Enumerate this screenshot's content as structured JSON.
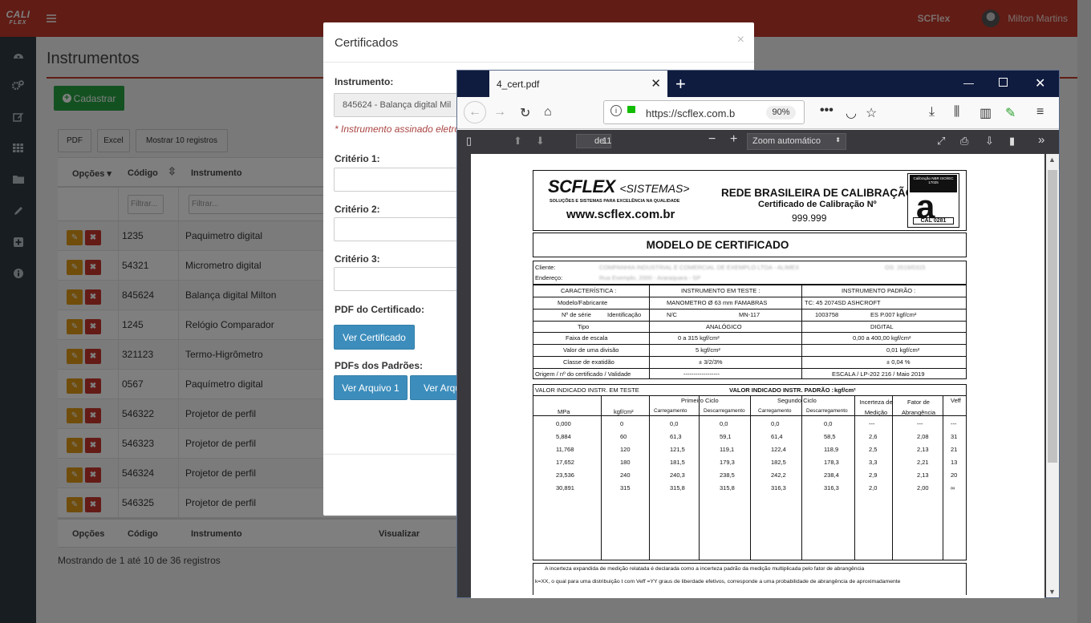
{
  "app": {
    "logo_line1": "CALI",
    "logo_line2": "FLEX",
    "brand": "SCFlex",
    "user": "Milton Martins"
  },
  "sidebar": [
    {
      "icon": "dashboard-icon"
    },
    {
      "icon": "cogs-icon"
    },
    {
      "icon": "edit-icon"
    },
    {
      "icon": "grid-icon"
    },
    {
      "icon": "folder-icon"
    },
    {
      "icon": "pencil-icon"
    },
    {
      "icon": "plus-square-icon"
    },
    {
      "icon": "info-icon"
    }
  ],
  "page": {
    "title": "Instrumentos",
    "add_button": "Cadastrar",
    "tools": [
      "PDF",
      "Excel",
      "Mostrar 10 registros"
    ],
    "columns": {
      "opcoes": "Opções",
      "codigo": "Código",
      "instrumento": "Instrumento",
      "visualizar": "Visualizar"
    },
    "filter_placeholder": "Filtrar...",
    "rows": [
      {
        "codigo": "1235",
        "instrumento": "Paquimetro digital"
      },
      {
        "codigo": "54321",
        "instrumento": "Micrometro digital"
      },
      {
        "codigo": "845624",
        "instrumento": "Balança digital Milton"
      },
      {
        "codigo": "1245",
        "instrumento": "Relógio Comparador"
      },
      {
        "codigo": "321123",
        "instrumento": "Termo-Higrômetro"
      },
      {
        "codigo": "0567",
        "instrumento": "Paquímetro digital"
      },
      {
        "codigo": "546322",
        "instrumento": "Projetor de perfil"
      },
      {
        "codigo": "546323",
        "instrumento": "Projetor de perfil"
      },
      {
        "codigo": "546324",
        "instrumento": "Projetor de perfil"
      },
      {
        "codigo": "546325",
        "instrumento": "Projetor de perfil"
      }
    ],
    "info": "Mostrando de 1 até 10 de 36 registros"
  },
  "modal": {
    "title": "Certificados",
    "close": "×",
    "instrumento_label": "Instrumento:",
    "instrumento_value": "845624 - Balança digital Mil",
    "note": "* Instrumento assinado eletro",
    "criterio1": "Critério 1:",
    "criterio2": "Critério 2:",
    "criterio3": "Critério 3:",
    "pdf_label": "PDF do Certificado:",
    "ver_certificado": "Ver Certificado",
    "padroes_label": "PDFs dos Padrões:",
    "ver_arquivo1": "Ver Arquivo 1",
    "ver_arquivo2": "Ver Arqui"
  },
  "browser": {
    "tab_title": "4_cert.pdf",
    "tab_close": "✕",
    "new_tab": "+",
    "url": "https://scflex.com.b",
    "zoom": "90%",
    "pdf_page": "1",
    "pdf_of": "de 1",
    "pdf_zoom": "Zoom automático"
  },
  "pdf": {
    "brand": "SCFLEX",
    "brand_suffix": "<SISTEMAS>",
    "slogan": "SOLUÇÕES E SISTEMAS PARA EXCELÊNCIA NA QUALIDADE",
    "site": "www.scflex.com.br",
    "rbc": "REDE BRASILEIRA DE CALIBRAÇÃO",
    "cert_label": "Certificado de Calibração  Nº",
    "cert_number": "999.999",
    "badge_top": "Calibração NBR ISO/IEC 17025",
    "badge_letter": "a",
    "badge_code": "CAL 0281",
    "model_title": "MODELO DE CERTIFICADO",
    "cliente_label": "Cliente:",
    "endereco_label": "Endereço:",
    "cliente_value": "COMPANHIA INDUSTRIAL E COMERCIAL DE EXEMPLO LTDA - ALIMEX",
    "endereco_value": "Rua Exemplo, 2000 - Araraquara - SP",
    "cliente_right": "OS: 2019/0315",
    "carac": "CARACTERÍSTICA :",
    "inst_teste": "INSTRUMENTO EM TESTE :",
    "inst_padrao": "INSTRUMENTO PADRÃO :",
    "spec_rows": [
      [
        "Modelo/Fabricante",
        "MANOMETRO Ø 63 mm FAMABRAS",
        "TC: 45 2074SD   ASHCROFT"
      ],
      [
        "Nº de série",
        "N/C",
        "MN-117",
        "1003758",
        "ES P.007 kgf/cm²"
      ],
      [
        "Tipo",
        "ANALÓGICO",
        "DIGITAL"
      ],
      [
        "Faixa de escala",
        "0 a 315  kgf/cm²",
        "0,00 a 400,00 kgf/cm²"
      ],
      [
        "Valor de uma divisão",
        "5 kgf/cm²",
        "0,01 kgf/cm²"
      ],
      [
        "Classe de exatidão",
        "± 3/2/3%",
        "± 0,04 %"
      ],
      [
        "Origem / nº do certificado / Validade",
        "------------------",
        "ESCALA / LP-202 216 / Maio 2019"
      ]
    ],
    "ident_label": "Identificação",
    "val_teste": "VALOR INDICADO INSTR. EM TESTE",
    "val_padrao": "VALOR INDICADO INSTR. PADRÃO :",
    "val_unit": "kgf/cm²",
    "primeiro": "Primeiro Ciclo",
    "segundo": "Segundo Ciclo",
    "incerteza": "Incerteza de Medição",
    "fator": "Fator de Abrangência",
    "veff": "Veff",
    "sub": [
      "MPa",
      "kgf/cm²",
      "Carregamento",
      "Descarregamento",
      "Carregamento",
      "Descarregamento"
    ],
    "data": [
      [
        "0,000",
        "0",
        "0,0",
        "0,0",
        "0,0",
        "0,0",
        "---",
        "---",
        "---"
      ],
      [
        "5,884",
        "60",
        "61,3",
        "59,1",
        "61,4",
        "58,5",
        "2,6",
        "2,08",
        "31"
      ],
      [
        "11,768",
        "120",
        "121,5",
        "119,1",
        "122,4",
        "118,9",
        "2,5",
        "2,13",
        "21"
      ],
      [
        "17,652",
        "180",
        "181,5",
        "179,3",
        "182,5",
        "178,3",
        "3,3",
        "2,21",
        "13"
      ],
      [
        "23,536",
        "240",
        "240,3",
        "238,5",
        "242,2",
        "238,4",
        "2,9",
        "2,13",
        "20"
      ],
      [
        "30,891",
        "315",
        "315,8",
        "315,8",
        "316,3",
        "316,3",
        "2,0",
        "2,00",
        "∞"
      ]
    ],
    "foot1": "A incerteza expandida de medição relatada é declarada   como  a   incerteza  padrão  da  medição  multiplicada  pelo fator de abrangência",
    "foot2": "k=XX, o qual  para uma distribuição t com Veff =YY graus de liberdade efetivos,  corresponde a uma probabilidade de abrangência de  aproximadamente"
  }
}
